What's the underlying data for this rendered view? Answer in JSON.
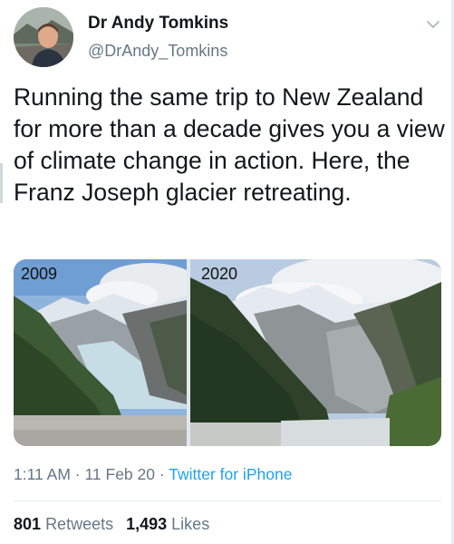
{
  "author": {
    "name": "Dr Andy Tomkins",
    "handle": "@DrAndy_Tomkins"
  },
  "tweet": {
    "text": "Running the same trip to New Zealand for more than a decade gives you a view of climate change in action. Here, the Franz Joseph glacier retreating."
  },
  "media": {
    "left_label": "2009",
    "right_label": "2020"
  },
  "meta": {
    "time": "1:11 AM",
    "separator": " · ",
    "date": "11 Feb 20",
    "source": "Twitter for iPhone"
  },
  "stats": {
    "retweets_count": "801",
    "retweets_label": "Retweets",
    "likes_count": "1,493",
    "likes_label": "Likes"
  },
  "colors": {
    "link": "#1da1f2",
    "secondary_text": "#657786",
    "primary_text": "#14171a"
  }
}
